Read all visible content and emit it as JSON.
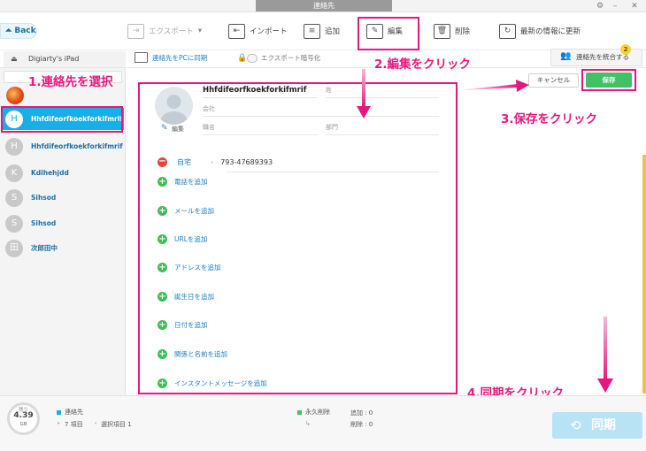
{
  "window": {
    "title": "連絡先"
  },
  "toolbar": {
    "back_label": "Back",
    "export_label": "エクスポート",
    "import_label": "インポート",
    "add_label": "追加",
    "edit_label": "編集",
    "delete_label": "削除",
    "refresh_label": "最新の情報に更新"
  },
  "subbar": {
    "device_name": "Digiarty's iPad",
    "sync_to_pc": "連絡先をPCに同期",
    "encrypt_label": "エクスポート暗号化",
    "merge_label": "連絡先を統合する",
    "merge_badge": "2"
  },
  "contacts": [
    {
      "initial": "H",
      "name": "Hhfdifeorfkoekforkifmrif",
      "selected": true
    },
    {
      "initial": "H",
      "name": "Hhfdifeorfkoekforkifmrif",
      "selected": false
    },
    {
      "initial": "K",
      "name": "Kdihehjdd",
      "selected": false
    },
    {
      "initial": "S",
      "name": "Sihsod",
      "selected": false
    },
    {
      "initial": "S",
      "name": "Sihsod",
      "selected": false
    },
    {
      "initial": "田",
      "name": "次郎田中",
      "selected": false
    }
  ],
  "detail": {
    "first_name": "Hhfdifeorfkoekforkifmrif",
    "last_name_label": "姓",
    "company_label": "会社",
    "job_label": "職名",
    "dept_label": "部門",
    "edit_photo_label": "編集",
    "phone": {
      "type": "自宅",
      "number": "793-47689393"
    },
    "add_items": [
      "電話を追加",
      "メールを追加",
      "URLを追加",
      "アドレスを追加",
      "誕生日を追加",
      "日付を追加",
      "関係と名前を追加",
      "インスタントメッセージを追加"
    ]
  },
  "actions": {
    "cancel_label": "キャンセル",
    "save_label": "保存"
  },
  "annotations": {
    "step1": "1.連絡先を選択",
    "step2": "2.編集をクリック",
    "step3": "3.保存をクリック",
    "step4": "4.同期をクリック"
  },
  "bottom": {
    "storage_label": "残り",
    "storage_value": "4.39",
    "storage_unit": "GB",
    "category_label": "連絡先",
    "items_text": "7 項目",
    "selected_text": "選択項目 1",
    "permanent_delete_label": "永久削除",
    "add_count_text": "追加 :  0",
    "delete_count_text": "削除 :  0",
    "sync_label": "同期"
  },
  "colors": {
    "accent_blue": "#18aee6",
    "annotation_pink": "#e5187f",
    "save_green": "#3fc164",
    "add_green": "#3bbf54",
    "remove_red": "#e8443e"
  }
}
